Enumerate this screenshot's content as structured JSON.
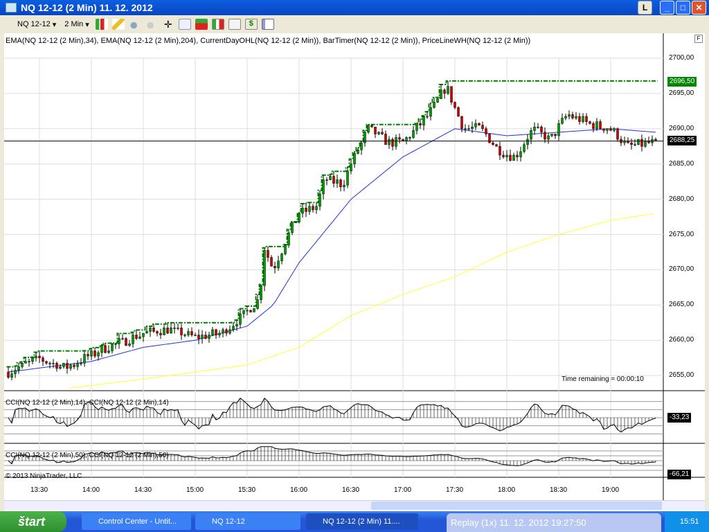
{
  "window": {
    "title": "NQ 12-12 (2 Min)  11. 12. 2012",
    "btn_l": "L",
    "btn_min": "_",
    "btn_max": "□",
    "btn_close": "✕"
  },
  "toolbar": {
    "instrument": "NQ 12-12",
    "interval": "2 Min",
    "icons": [
      "bar-style-icon",
      "pencil-icon",
      "zoom-in-icon",
      "zoom-out-icon",
      "crosshair-icon",
      "magnifier-icon",
      "order-entry-icon",
      "chart-trader-icon",
      "indicators-icon",
      "dollar-icon",
      "properties-icon"
    ]
  },
  "chart": {
    "indicators_label": "EMA(NQ 12-12 (2 Min),34), EMA(NQ 12-12 (2 Min),204), CurrentDayOHL(NQ 12-12 (2 Min)), BarTimer(NQ 12-12 (2 Min)), PriceLineWH(NQ 12-12 (2 Min))",
    "price_ticks": [
      "2700,00",
      "2695,00",
      "2690,00",
      "2685,00",
      "2680,00",
      "2675,00",
      "2670,00",
      "2665,00",
      "2660,00",
      "2655,00"
    ],
    "time_ticks": [
      "13:30",
      "14:00",
      "14:30",
      "15:00",
      "15:30",
      "16:00",
      "16:30",
      "17:00",
      "17:30",
      "18:00",
      "18:30",
      "19:00"
    ],
    "last_price": "2688,25",
    "day_high": "2696,50",
    "timer_text": "Time remaining = 00:00:10",
    "copyright": "© 2013 NinjaTrader, LLC",
    "cci1_label": "CCI(NQ 12-12 (2 Min),14), CCI(NQ 12-12 (2 Min),14)",
    "cci1_value": "-33,23",
    "cci2_label": "CCI(NQ 12-12 (2 Min),50), CCI(NQ 12-12 (2 Min),50)",
    "cci2_value": "-66,21",
    "colors": {
      "up": "#00a000",
      "down": "#d00000",
      "ema34": "#2030e0",
      "ema204": "#ffff30",
      "high_line": "#008000"
    },
    "price_path": [
      [
        "13:12",
        2655.5
      ],
      [
        "13:30",
        2657.5
      ],
      [
        "13:45",
        2656
      ],
      [
        "14:00",
        2658
      ],
      [
        "14:15",
        2659.5
      ],
      [
        "14:30",
        2661
      ],
      [
        "14:45",
        2661.5
      ],
      [
        "15:00",
        2660.5
      ],
      [
        "15:15",
        2661
      ],
      [
        "15:30",
        2664
      ],
      [
        "15:37",
        2666
      ],
      [
        "15:40",
        2673
      ],
      [
        "15:45",
        2670
      ],
      [
        "15:52",
        2674
      ],
      [
        "16:00",
        2678
      ],
      [
        "16:10",
        2679
      ],
      [
        "16:15",
        2683
      ],
      [
        "16:25",
        2682
      ],
      [
        "16:30",
        2685
      ],
      [
        "16:40",
        2690
      ],
      [
        "16:52",
        2688
      ],
      [
        "17:00",
        2688
      ],
      [
        "17:15",
        2692
      ],
      [
        "17:25",
        2696
      ],
      [
        "17:35",
        2690
      ],
      [
        "17:45",
        2690
      ],
      [
        "17:55",
        2687
      ],
      [
        "18:05",
        2686
      ],
      [
        "18:15",
        2690
      ],
      [
        "18:25",
        2688.5
      ],
      [
        "18:35",
        2692
      ],
      [
        "18:50",
        2690.5
      ],
      [
        "19:00",
        2690
      ],
      [
        "19:10",
        2687.5
      ],
      [
        "19:26",
        2688.25
      ]
    ],
    "ema34_path": [
      [
        "13:12",
        2655.5
      ],
      [
        "14:00",
        2657
      ],
      [
        "14:30",
        2659
      ],
      [
        "15:00",
        2660
      ],
      [
        "15:30",
        2662
      ],
      [
        "15:45",
        2665
      ],
      [
        "16:00",
        2671
      ],
      [
        "16:30",
        2680
      ],
      [
        "17:00",
        2686
      ],
      [
        "17:30",
        2690
      ],
      [
        "18:00",
        2689
      ],
      [
        "18:30",
        2689.5
      ],
      [
        "19:00",
        2690
      ],
      [
        "19:26",
        2689.5
      ]
    ],
    "ema204_path": [
      [
        "13:47",
        2653.2
      ],
      [
        "14:30",
        2654.5
      ],
      [
        "15:30",
        2656.5
      ],
      [
        "16:00",
        2659
      ],
      [
        "16:30",
        2663.5
      ],
      [
        "17:00",
        2666.5
      ],
      [
        "17:30",
        2669
      ],
      [
        "18:00",
        2672.5
      ],
      [
        "18:30",
        2675
      ],
      [
        "19:00",
        2677
      ],
      [
        "19:26",
        2678
      ]
    ]
  },
  "taskbar": {
    "start": "štart",
    "tasks": [
      "Control Center - Untit...",
      "NQ 12-12",
      "NQ 12-12 (2 Min)  11...."
    ],
    "replay": "Replay (1x) 11. 12. 2012 19:27:50",
    "clock": "15:51"
  }
}
